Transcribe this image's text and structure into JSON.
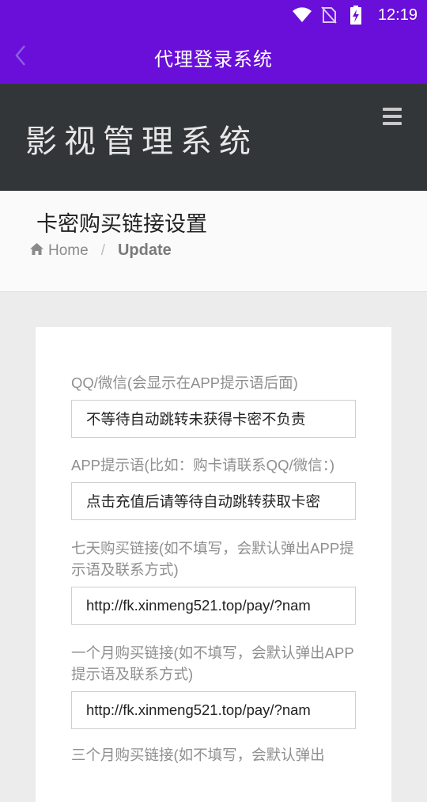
{
  "status_bar": {
    "time": "12:19",
    "icons": [
      "wifi-icon",
      "no-sim-icon",
      "battery-charging-icon"
    ]
  },
  "app_bar": {
    "title": "代理登录系统",
    "back_icon": "chevron-left-icon"
  },
  "brand": {
    "title": "影视管理系统",
    "menu_icon": "hamburger-menu-icon"
  },
  "page": {
    "title": "卡密购买链接设置",
    "breadcrumb": {
      "home_icon": "home-icon",
      "home": "Home",
      "separator": "/",
      "current": "Update"
    }
  },
  "form": {
    "fields": [
      {
        "label": "QQ/微信(会显示在APP提示语后面)",
        "value": "不等待自动跳转未获得卡密不负责"
      },
      {
        "label": "APP提示语(比如：购卡请联系QQ/微信：)",
        "value": "点击充值后请等待自动跳转获取卡密"
      },
      {
        "label": "七天购买链接(如不填写，会默认弹出APP提示语及联系方式)",
        "value": "http://fk.xinmeng521.top/pay/?nam"
      },
      {
        "label": "一个月购买链接(如不填写，会默认弹出APP提示语及联系方式)",
        "value": "http://fk.xinmeng521.top/pay/?nam"
      },
      {
        "label": "三个月购买链接(如不填写，会默认弹出"
      }
    ]
  },
  "colors": {
    "primary": "#6a0fd9",
    "brand_bar": "#333638",
    "background": "#ececec"
  }
}
